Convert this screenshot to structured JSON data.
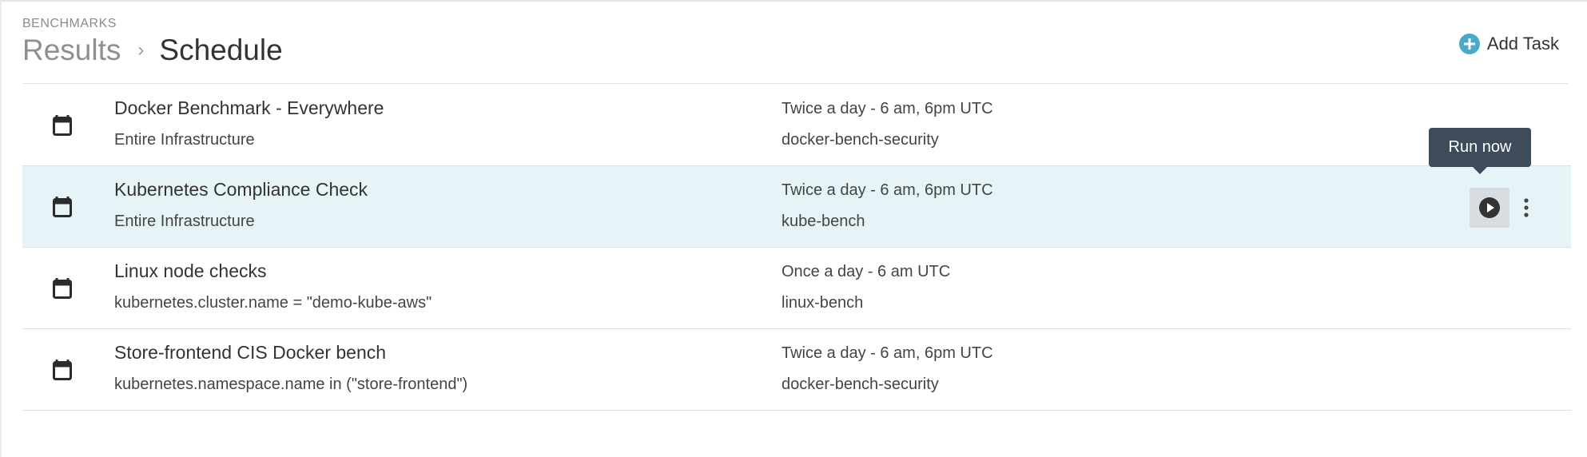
{
  "header": {
    "section_label": "BENCHMARKS",
    "breadcrumb_parent": "Results",
    "breadcrumb_separator": "›",
    "breadcrumb_current": "Schedule",
    "add_task_label": "Add Task"
  },
  "tasks": [
    {
      "name": "Docker Benchmark - Everywhere",
      "scope": "Entire Infrastructure",
      "schedule": "Twice a day - 6 am, 6pm UTC",
      "benchmark": "docker-bench-security"
    },
    {
      "name": "Kubernetes Compliance Check",
      "scope": "Entire Infrastructure",
      "schedule": "Twice a day - 6 am, 6pm UTC",
      "benchmark": "kube-bench"
    },
    {
      "name": "Linux node checks",
      "scope": "kubernetes.cluster.name = \"demo-kube-aws\"",
      "schedule": "Once a day - 6 am UTC",
      "benchmark": "linux-bench"
    },
    {
      "name": "Store-frontend CIS Docker bench",
      "scope": "kubernetes.namespace.name in (\"store-frontend\")",
      "schedule": "Twice a day - 6 am, 6pm UTC",
      "benchmark": "docker-bench-security"
    }
  ],
  "tooltip": {
    "text": "Run now"
  },
  "colors": {
    "accent": "#4aa8c9",
    "row_highlight": "#e6f3f7",
    "tooltip_bg": "#3d4b5a"
  },
  "icons": {
    "add": "plus-circle-icon",
    "row": "calendar-icon",
    "run": "play-circle-icon",
    "more": "more-vertical-icon"
  }
}
